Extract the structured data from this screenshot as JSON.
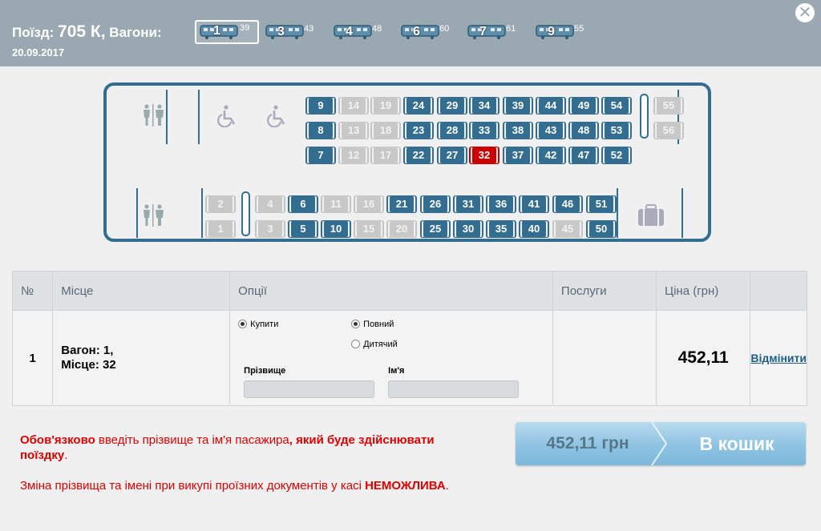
{
  "header": {
    "train_prefix": "Поїзд:",
    "train_number": "705 К,",
    "wagons_label": "Вагони:",
    "date": "20.09.2017",
    "wagons": [
      {
        "number": "1",
        "free": "39"
      },
      {
        "number": "3",
        "free": "43"
      },
      {
        "number": "4",
        "free": "48"
      },
      {
        "number": "6",
        "free": "60"
      },
      {
        "number": "7",
        "free": "61"
      },
      {
        "number": "9",
        "free": "55"
      }
    ],
    "close_symbol": "✕"
  },
  "car": {
    "top_rows": {
      "row1": [
        {
          "n": "9",
          "s": "free"
        },
        {
          "n": "14",
          "s": "busy"
        },
        {
          "n": "19",
          "s": "busy"
        },
        {
          "n": "24",
          "s": "free"
        },
        {
          "n": "29",
          "s": "free"
        },
        {
          "n": "34",
          "s": "free"
        },
        {
          "n": "39",
          "s": "free"
        },
        {
          "n": "44",
          "s": "free"
        },
        {
          "n": "49",
          "s": "free"
        },
        {
          "n": "54",
          "s": "free"
        },
        {
          "n": "55",
          "s": "busy"
        }
      ],
      "row2": [
        {
          "n": "8",
          "s": "free"
        },
        {
          "n": "13",
          "s": "busy"
        },
        {
          "n": "18",
          "s": "busy"
        },
        {
          "n": "23",
          "s": "free"
        },
        {
          "n": "28",
          "s": "free"
        },
        {
          "n": "33",
          "s": "free"
        },
        {
          "n": "38",
          "s": "free"
        },
        {
          "n": "43",
          "s": "free"
        },
        {
          "n": "48",
          "s": "free"
        },
        {
          "n": "53",
          "s": "free"
        },
        {
          "n": "56",
          "s": "busy"
        }
      ],
      "row3": [
        {
          "n": "7",
          "s": "free"
        },
        {
          "n": "12",
          "s": "busy"
        },
        {
          "n": "17",
          "s": "busy"
        },
        {
          "n": "22",
          "s": "free"
        },
        {
          "n": "27",
          "s": "free"
        },
        {
          "n": "32",
          "s": "selected"
        },
        {
          "n": "37",
          "s": "free"
        },
        {
          "n": "42",
          "s": "free"
        },
        {
          "n": "47",
          "s": "free"
        },
        {
          "n": "52",
          "s": "free"
        }
      ]
    },
    "bottom_rows": {
      "row1": [
        {
          "n": "2",
          "s": "busy"
        },
        {
          "n": "4",
          "s": "busy"
        },
        {
          "n": "6",
          "s": "free"
        },
        {
          "n": "11",
          "s": "busy"
        },
        {
          "n": "16",
          "s": "busy"
        },
        {
          "n": "21",
          "s": "free"
        },
        {
          "n": "26",
          "s": "free"
        },
        {
          "n": "31",
          "s": "free"
        },
        {
          "n": "36",
          "s": "free"
        },
        {
          "n": "41",
          "s": "free"
        },
        {
          "n": "46",
          "s": "free"
        },
        {
          "n": "51",
          "s": "free"
        }
      ],
      "row2": [
        {
          "n": "1",
          "s": "busy"
        },
        {
          "n": "3",
          "s": "busy"
        },
        {
          "n": "5",
          "s": "free"
        },
        {
          "n": "10",
          "s": "free"
        },
        {
          "n": "15",
          "s": "busy"
        },
        {
          "n": "20",
          "s": "busy"
        },
        {
          "n": "25",
          "s": "free"
        },
        {
          "n": "30",
          "s": "free"
        },
        {
          "n": "35",
          "s": "free"
        },
        {
          "n": "40",
          "s": "free"
        },
        {
          "n": "45",
          "s": "busy"
        },
        {
          "n": "50",
          "s": "free"
        }
      ]
    },
    "icons": [
      "wc-icon",
      "wheelchair-icon",
      "luggage-icon"
    ]
  },
  "table": {
    "headers": {
      "no": "№",
      "place": "Місце",
      "options": "Опції",
      "services": "Послуги",
      "price": "Ціна (грн)"
    },
    "row": {
      "no": "1",
      "place_line1": "Вагон: 1,",
      "place_line2": "Місце: 32",
      "opt_buy": "Купити",
      "opt_full": "Повний",
      "opt_child": "Дитячий",
      "surname_label": "Прізвище",
      "name_label": "Ім'я",
      "surname_value": "",
      "name_value": "",
      "price": "452,11",
      "cancel": "Відмінити"
    }
  },
  "notes": {
    "n1_a": "Обов'язково",
    "n1_b": " введіть прізвище та ім'я пасажира",
    "n1_c": ", який буде здійснювати поїздку",
    "n1_d": ".",
    "n2_a": "Зміна прізвища та імені при викупі проїзних документів у касі ",
    "n2_b": "НЕМОЖЛИВА",
    "n2_c": "."
  },
  "cart": {
    "price": "452,11 грн",
    "label": "В кошик"
  },
  "colors": {
    "header_bg": "#9aa8b2",
    "seat_free": "#336e90",
    "seat_busy": "#c8c8c8",
    "seat_selected": "#cc0000",
    "warning": "#e00000",
    "cart_button": "#8ec3e2"
  }
}
